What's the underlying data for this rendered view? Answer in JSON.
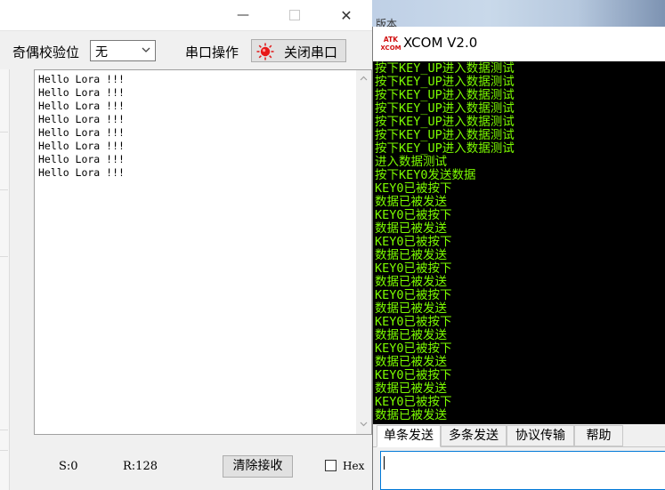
{
  "left_window": {
    "controls": {
      "minimize": "—",
      "close": "✕"
    },
    "toolbar": {
      "parity_label": "奇偶校验位",
      "parity_value": "无",
      "port_op_label": "串口操作",
      "close_port_label": "关闭串口"
    },
    "receive_text": "Hello Lora !!!\nHello Lora !!!\nHello Lora !!!\nHello Lora !!!\nHello Lora !!!\nHello Lora !!!\nHello Lora !!!\nHello Lora !!!",
    "status": {
      "sent": "S:0",
      "received": "R:128",
      "clear_label": "清除接收",
      "hex_label": "Hex"
    }
  },
  "background_label": "版本",
  "xcom": {
    "logo_text_top": "ATK",
    "logo_text_bottom": "XCOM",
    "title": "XCOM V2.0",
    "terminal_text": "按下KEY_UP进入数据测试\n按下KEY_UP进入数据测试\n按下KEY_UP进入数据测试\n按下KEY_UP进入数据测试\n按下KEY_UP进入数据测试\n按下KEY_UP进入数据测试\n按下KEY_UP进入数据测试\n进入数据测试\n按下KEY0发送数据\nKEY0已被按下\n数据已被发送\nKEY0已被按下\n数据已被发送\nKEY0已被按下\n数据已被发送\nKEY0已被按下\n数据已被发送\nKEY0已被按下\n数据已被发送\nKEY0已被按下\n数据已被发送\nKEY0已被按下\n数据已被发送\nKEY0已被按下\n数据已被发送\nKEY0已被按下\n数据已被发送",
    "tabs": [
      "单条发送",
      "多条发送",
      "协议传输",
      "帮助"
    ],
    "terminal_color": "#7cfc00"
  }
}
